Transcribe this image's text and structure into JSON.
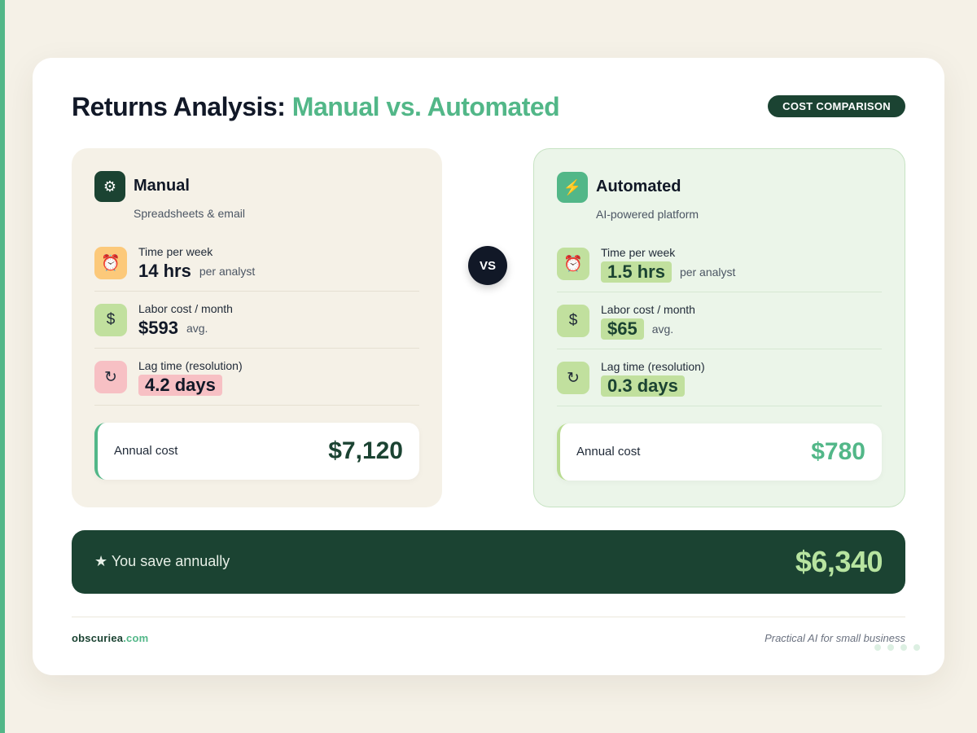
{
  "header": {
    "title_main": "Returns Analysis: ",
    "title_accent": "Manual vs. Automated",
    "badge": "COST COMPARISON"
  },
  "manual": {
    "icon": "gear-icon",
    "icon_glyph": "⚙",
    "title": "Manual",
    "subtitle": "Spreadsheets & email",
    "rows": [
      {
        "icon": "alarm-clock-icon",
        "glyph": "⏰",
        "label": "Time per week",
        "value": "14 hrs",
        "unit": "per analyst"
      },
      {
        "icon": "dollar-icon",
        "glyph": "$",
        "label": "Labor cost / month",
        "value": "$593",
        "unit": "avg."
      },
      {
        "icon": "refresh-icon",
        "glyph": "↻",
        "label": "Lag time (resolution)",
        "value": "4.2 days",
        "unit": ""
      }
    ],
    "annual_label": "Annual cost",
    "annual_value": "$7,120"
  },
  "vs_label": "VS",
  "automated": {
    "icon": "lightning-icon",
    "icon_glyph": "⚡",
    "title": "Automated",
    "subtitle": "AI-powered platform",
    "rows": [
      {
        "icon": "alarm-clock-icon",
        "glyph": "⏰",
        "label": "Time per week",
        "value": "1.5 hrs",
        "unit": "per analyst"
      },
      {
        "icon": "dollar-icon",
        "glyph": "$",
        "label": "Labor cost / month",
        "value": "$65",
        "unit": "avg."
      },
      {
        "icon": "refresh-icon",
        "glyph": "↻",
        "label": "Lag time (resolution)",
        "value": "0.3 days",
        "unit": ""
      }
    ],
    "annual_label": "Annual cost",
    "annual_value": "$780"
  },
  "savings": {
    "label": "★ You save annually",
    "value": "$6,340"
  },
  "footer": {
    "brand_name": "obscuriea",
    "brand_tld": ".com",
    "tagline": "Practical AI for small business"
  },
  "colors": {
    "accent": "#52b788",
    "dark_green": "#1b4332",
    "background": "#f5f1e7"
  }
}
